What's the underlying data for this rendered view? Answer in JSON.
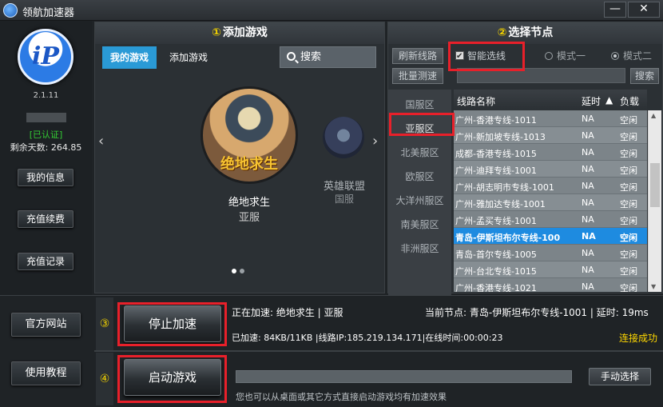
{
  "window": {
    "title": "领航加速器",
    "minimize_label": "—",
    "close_label": "✕"
  },
  "sidebar": {
    "logo_text": "iP",
    "version": "2.1.11",
    "verified": "[已认证]",
    "days_left": "剩余天数: 264.85",
    "buttons": [
      "我的信息",
      "充值续费",
      "充值记录"
    ]
  },
  "game_panel": {
    "step": "①",
    "title": "添加游戏",
    "tabs": [
      "我的游戏",
      "添加游戏"
    ],
    "search_label": "搜索",
    "games": [
      {
        "name": "绝地求生",
        "region": "亚服",
        "logo_text": "绝地求生"
      },
      {
        "name": "英雄联盟",
        "region": "国服"
      }
    ],
    "carousel_pages": 2,
    "carousel_active": 1
  },
  "node_panel": {
    "step": "②",
    "title": "选择节点",
    "refresh_label": "刷新线路",
    "batch_label": "批量测速",
    "smart_route_label": "智能选线",
    "smart_route_checked": true,
    "modes": [
      "模式一",
      "模式二"
    ],
    "active_mode": "模式二",
    "search_label": "搜索",
    "regions": [
      "国服区",
      "亚服区",
      "北美服区",
      "欧服区",
      "大洋州服区",
      "南美服区",
      "非洲服区"
    ],
    "active_region": "亚服区",
    "columns": {
      "name": "线路名称",
      "delay": "延时",
      "sort_indicator": "▲",
      "load": "负载"
    },
    "routes": [
      {
        "name": "广州-香港专线-1011",
        "delay": "NA",
        "load": "空闲"
      },
      {
        "name": "广州-新加坡专线-1013",
        "delay": "NA",
        "load": "空闲"
      },
      {
        "name": "成都-香港专线-1015",
        "delay": "NA",
        "load": "空闲"
      },
      {
        "name": "广州-迪拜专线-1001",
        "delay": "NA",
        "load": "空闲"
      },
      {
        "name": "广州-胡志明市专线-1001",
        "delay": "NA",
        "load": "空闲"
      },
      {
        "name": "广州-雅加达专线-1001",
        "delay": "NA",
        "load": "空闲"
      },
      {
        "name": "广州-孟买专线-1001",
        "delay": "NA",
        "load": "空闲"
      },
      {
        "name": "青岛-伊斯坦布尔专线-100",
        "delay": "NA",
        "load": "空闲",
        "selected": true
      },
      {
        "name": "青岛-首尔专线-1005",
        "delay": "NA",
        "load": "空闲"
      },
      {
        "name": "广州-台北专线-1015",
        "delay": "NA",
        "load": "空闲"
      },
      {
        "name": "广州-香港专线-1021",
        "delay": "NA",
        "load": "空闲"
      }
    ]
  },
  "bottom": {
    "side_buttons": [
      "官方网站",
      "使用教程"
    ],
    "step3": "③",
    "step4": "④",
    "stop_label": "停止加速",
    "launch_label": "启动游戏",
    "accelerating": "正在加速: 绝地求生 | 亚服",
    "current_node": "当前节点: 青岛-伊斯坦布尔专线-1001 | 延时: 19ms",
    "speed_info": "已加速: 84KB/11KB |线路IP:185.219.134.171|在线时间:00:00:23",
    "connected": "连接成功",
    "manual_label": "手动选择",
    "launch_progress": 0,
    "hint": "您也可以从桌面或其它方式直接启动游戏均有加速效果"
  },
  "colors": {
    "accent": "#2a9ad6",
    "selected_row": "#1e8be0",
    "highlight": "#e8202a",
    "status_ok": "#ffd800",
    "step_number": "#f0d000"
  }
}
